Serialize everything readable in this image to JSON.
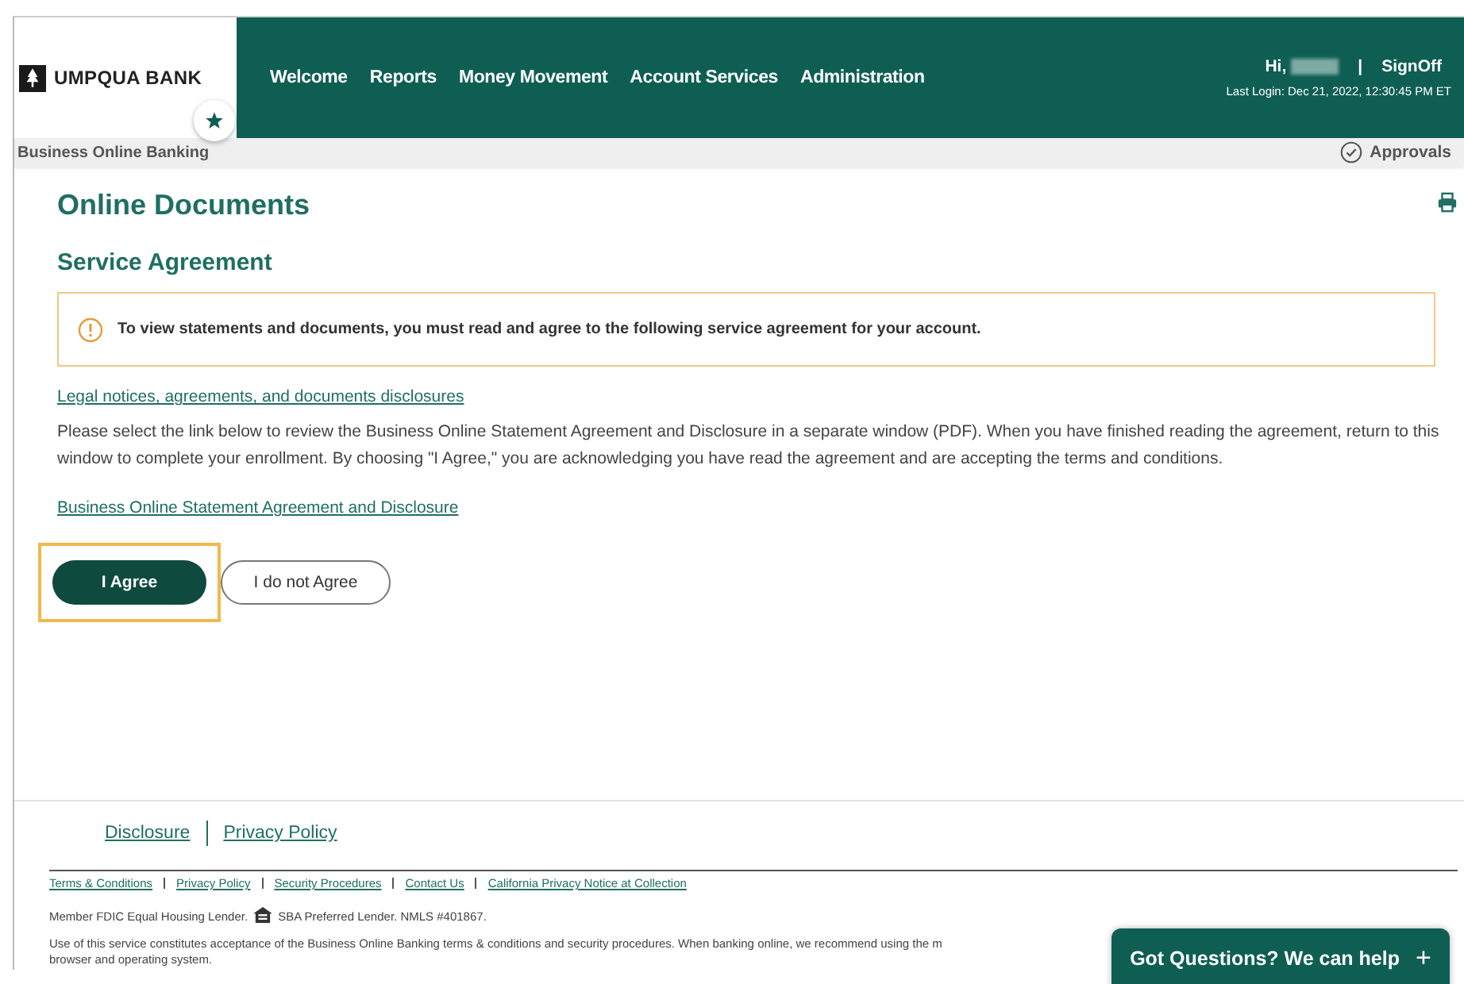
{
  "header": {
    "logo": "UMPQUA BANK",
    "nav": [
      {
        "label": "Welcome",
        "selected": false
      },
      {
        "label": "Reports",
        "selected": false
      },
      {
        "label": "Money Movement",
        "selected": false
      },
      {
        "label": "Account Services",
        "selected": false
      },
      {
        "label": "Administration",
        "selected": false
      }
    ],
    "greeting": "Hi,",
    "separator": "|",
    "signoff": "SignOff",
    "last_login": "Last Login: Dec 21, 2022, 12:30:45 PM ET"
  },
  "subbar": {
    "title": "Business Online Banking",
    "approvals": "Approvals"
  },
  "page": {
    "title": "Online Documents",
    "subtitle": "Service Agreement",
    "alert": "To view statements and documents, you must read and agree to the following service agreement for your account.",
    "link_1": "Legal notices, agreements, and documents disclosures",
    "body": "Please select the link below to review the Business Online Statement Agreement and Disclosure in a separate window (PDF). When you have finished reading the agreement, return to this window to complete your enrollment. By choosing \"I Agree,\" you are acknowledging you have read the agreement and are accepting the terms and conditions.",
    "link_2": "Business Online Statement Agreement and Disclosure",
    "buttons": [
      {
        "label": "I Agree",
        "kind": "primary",
        "highlighted": true
      },
      {
        "label": "I do not Agree",
        "kind": "secondary",
        "highlighted": false
      }
    ]
  },
  "footer": {
    "links": [
      "Disclosure",
      "Privacy Policy"
    ],
    "legal_links": [
      "Terms & Conditions",
      "Privacy Policy",
      "Security Procedures",
      "Contact Us",
      "California Privacy Notice at Collection"
    ],
    "member_1": "Member FDIC Equal Housing Lender.",
    "member_2": "SBA Preferred Lender. NMLS #401867.",
    "notice_1": "Use of this service constitutes acceptance of the Business Online Banking terms & conditions and security procedures. When banking online, we recommend using the m",
    "notice_2": "browser and operating system."
  },
  "chat": {
    "label": "Got Questions? We can help",
    "icon": "+"
  }
}
